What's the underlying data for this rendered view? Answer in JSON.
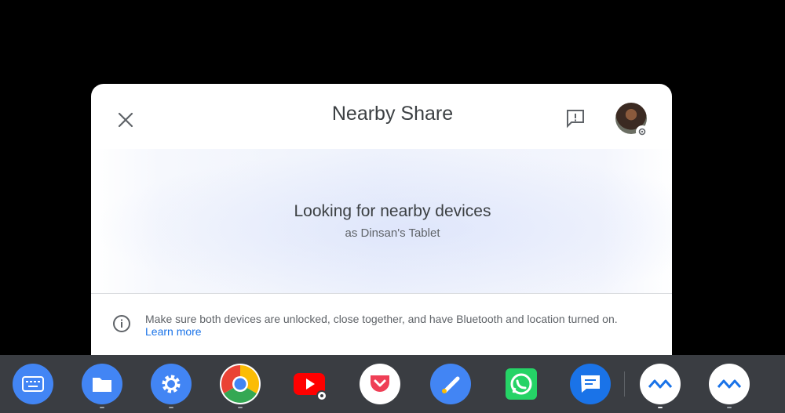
{
  "dialog": {
    "title": "Nearby Share",
    "status_title": "Looking for nearby devices",
    "status_subtitle": "as Dinsan's Tablet",
    "info_text": "Make sure both devices are unlocked, close together, and have Bluetooth and location turned on.",
    "learn_more": "Learn more",
    "icons": {
      "close": "close-icon",
      "feedback": "feedback-icon",
      "info": "info-icon",
      "avatar_badge": "settings-icon"
    }
  },
  "shelf": {
    "apps": [
      {
        "name": "keyboard",
        "icon": "keyboard-icon",
        "color": "#4285f4"
      },
      {
        "name": "files",
        "icon": "folder-icon",
        "color": "#4285f4"
      },
      {
        "name": "settings",
        "icon": "gear-icon",
        "color": "#4285f4"
      },
      {
        "name": "chrome",
        "icon": "chrome-icon",
        "color": "#ea4335"
      },
      {
        "name": "youtube",
        "icon": "play-icon",
        "color": "#ff0000"
      },
      {
        "name": "pocket",
        "icon": "pocket-icon",
        "color": "#ef3f56"
      },
      {
        "name": "pen",
        "icon": "pen-icon",
        "color": "#4285f4"
      },
      {
        "name": "whatsapp",
        "icon": "whatsapp-icon",
        "color": "#25d366"
      },
      {
        "name": "messages",
        "icon": "message-icon",
        "color": "#1a73e8"
      },
      {
        "name": "app-a",
        "icon": "wave-icon",
        "color": "#1a73e8"
      },
      {
        "name": "app-b",
        "icon": "wave-icon",
        "color": "#1a73e8"
      }
    ]
  }
}
